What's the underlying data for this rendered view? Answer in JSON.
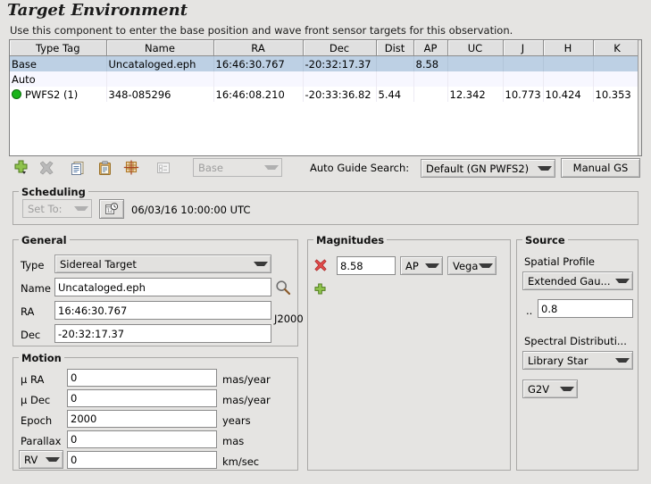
{
  "header": {
    "title": "Target Environment",
    "description": "Use this component to enter the base position and wave front sensor targets for this observation."
  },
  "target_table": {
    "columns": [
      "Type Tag",
      "Name",
      "RA",
      "Dec",
      "Dist",
      "AP",
      "UC",
      "J",
      "H",
      "K"
    ],
    "rows": [
      {
        "type_tag": "Base",
        "name": "Uncataloged.eph",
        "ra": "16:46:30.767",
        "dec": "-20:32:17.37",
        "dist": "",
        "ap": "8.58",
        "uc": "",
        "j": "",
        "h": "",
        "k": "",
        "state": "selected",
        "indent": false,
        "dot": false
      },
      {
        "type_tag": "Auto",
        "name": "",
        "ra": "",
        "dec": "",
        "dist": "",
        "ap": "",
        "uc": "",
        "j": "",
        "h": "",
        "k": "",
        "state": "alt",
        "indent": false,
        "dot": false
      },
      {
        "type_tag": "PWFS2 (1)",
        "name": "348-085296",
        "ra": "16:46:08.210",
        "dec": "-20:33:36.82",
        "dist": "5.44",
        "ap": "",
        "uc": "12.342",
        "j": "10.773",
        "h": "10.424",
        "k": "10.353",
        "state": "plain",
        "indent": true,
        "dot": true,
        "dot_color": "#19b319"
      }
    ]
  },
  "toolbar": {
    "add_icon": "add-plus-icon",
    "remove_icon": "remove-x-icon",
    "copy_icon": "copy-icon",
    "paste_icon": "paste-icon",
    "target-grid_icon": "target-grid-icon",
    "properties_icon": "properties-list-icon",
    "primary_combo_value": "Base",
    "auto_guide_label": "Auto Guide Search:",
    "auto_guide_value": "Default (GN PWFS2)",
    "manual_gs_label": "Manual GS"
  },
  "scheduling": {
    "legend": "Scheduling",
    "set_to_label": "Set To:",
    "clock_icon": "clock-schedule-icon",
    "datetime": "06/03/16 10:00:00 UTC"
  },
  "general": {
    "legend": "General",
    "type_label": "Type",
    "type_value": "Sidereal Target",
    "name_label": "Name",
    "name_value": "Uncataloged.eph",
    "search_icon": "magnifier-icon",
    "ra_label": "RA",
    "ra_value": "16:46:30.767",
    "dec_label": "Dec",
    "dec_value": "-20:32:17.37",
    "epoch_note": "J2000"
  },
  "motion": {
    "legend": "Motion",
    "pm_ra_label": "μ RA",
    "pm_ra_value": "0",
    "pm_ra_unit": "mas/year",
    "pm_dec_label": "μ Dec",
    "pm_dec_value": "0",
    "pm_dec_unit": "mas/year",
    "epoch_label": "Epoch",
    "epoch_value": "2000",
    "epoch_unit": "years",
    "parallax_label": "Parallax",
    "parallax_value": "0",
    "parallax_unit": "mas",
    "rv_combo_value": "RV",
    "rv_value": "0",
    "rv_unit": "km/sec"
  },
  "magnitudes": {
    "legend": "Magnitudes",
    "remove_icon": "remove-magnitude-icon",
    "add_icon": "add-magnitude-icon",
    "value": "8.58",
    "band": "AP",
    "system": "Vega"
  },
  "source": {
    "legend": "Source",
    "spatial_profile_label": "Spatial Profile",
    "spatial_profile_value": "Extended Gau...",
    "fwhm_label": "..",
    "fwhm_value": "0.8",
    "spectral_label": "Spectral Distributi...",
    "spectral_value": "Library Star",
    "star_type_value": "G2V"
  },
  "colors": {
    "window_bg": "#e5e4e2",
    "selection": "#bdd0e4",
    "alt_row": "#f7f7ff",
    "guide_dot": "#19b319"
  }
}
